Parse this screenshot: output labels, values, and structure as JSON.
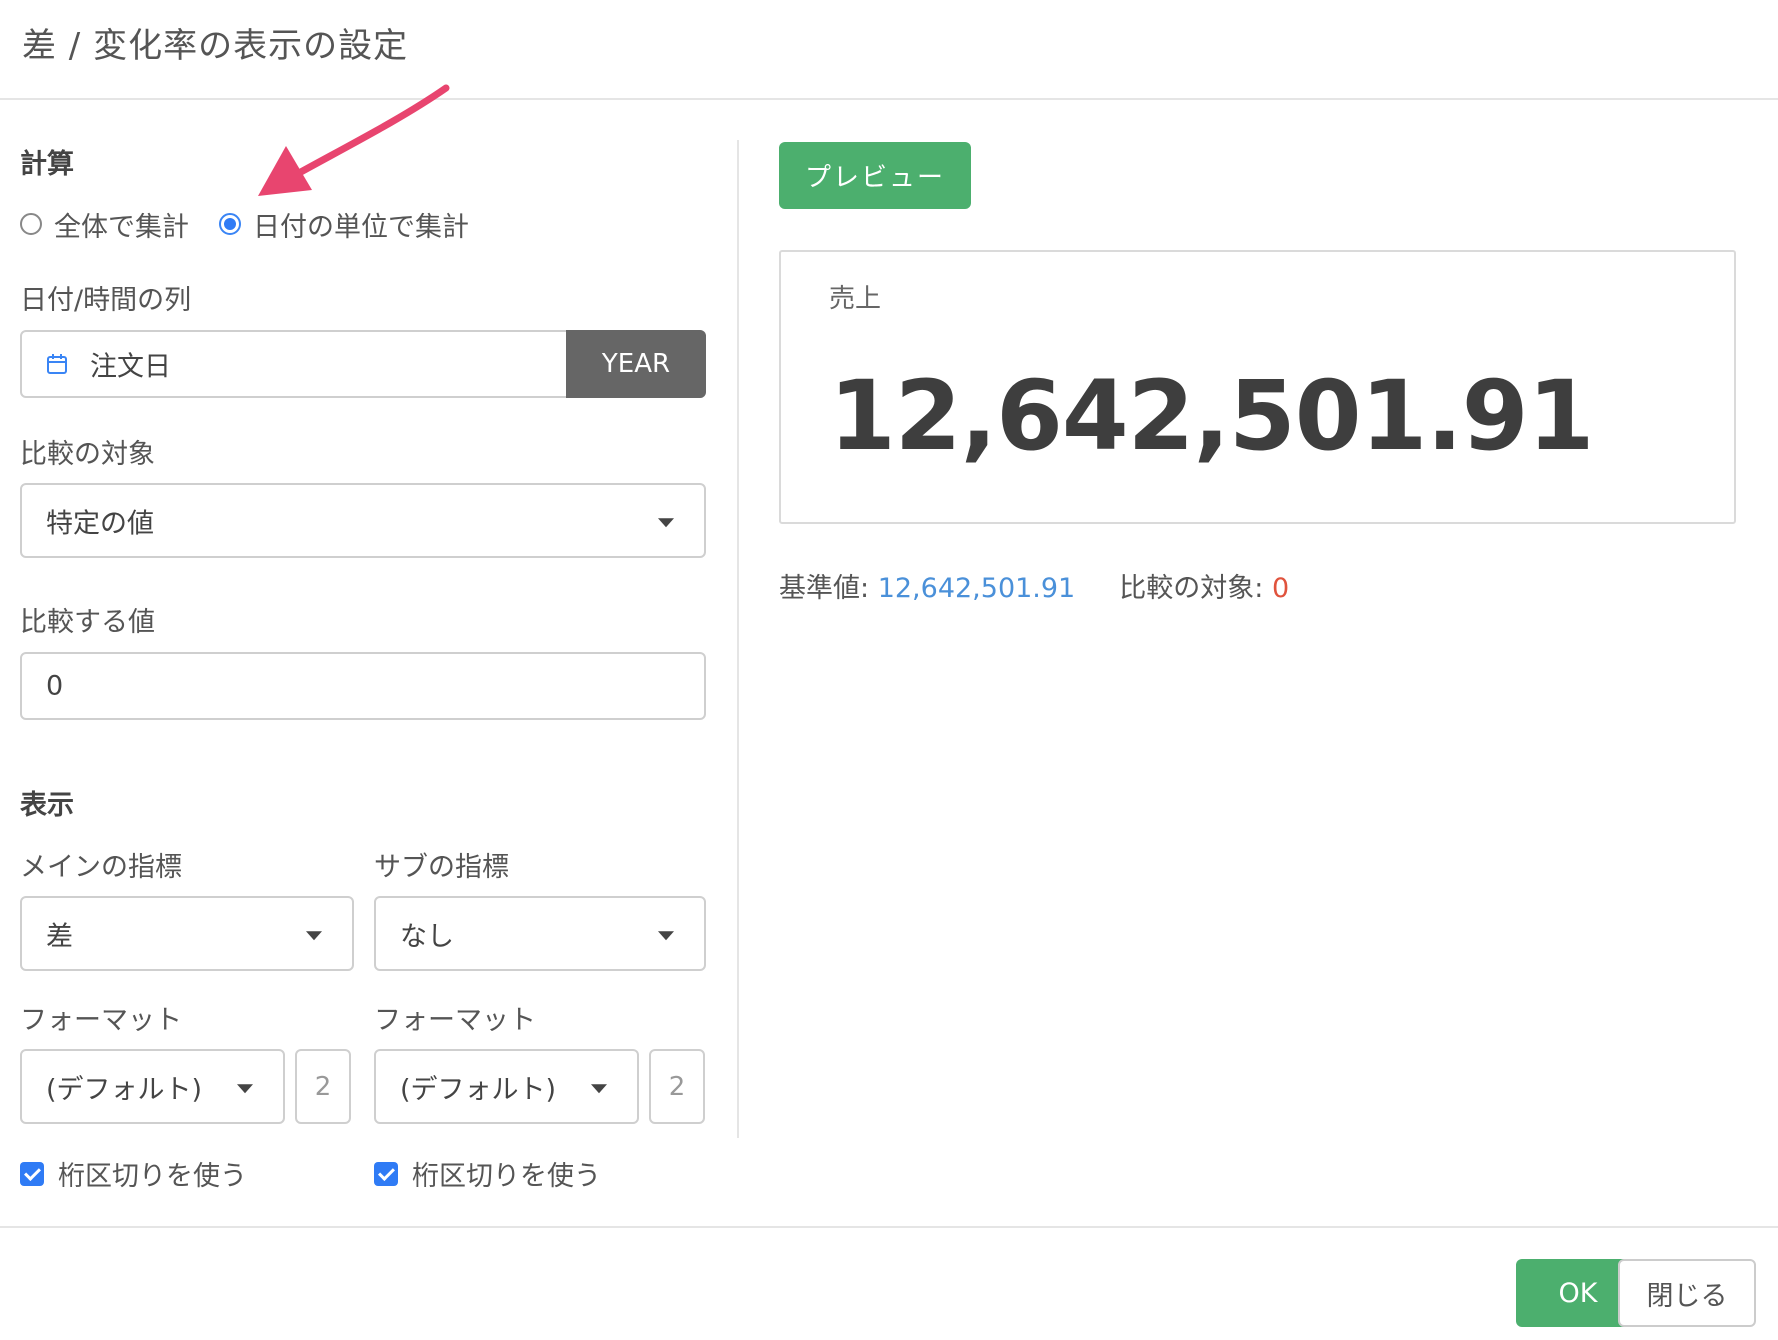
{
  "header": {
    "title": "差 / 変化率の表示の設定"
  },
  "calculation": {
    "section_title": "計算",
    "options": [
      {
        "label": "全体で集計",
        "checked": false
      },
      {
        "label": "日付の単位で集計",
        "checked": true
      }
    ]
  },
  "date_column": {
    "label": "日付/時間の列",
    "value": "注文日",
    "unit": "YEAR"
  },
  "compare_target": {
    "label": "比較の対象",
    "value": "特定の値"
  },
  "compare_value": {
    "label": "比較する値",
    "value": "0"
  },
  "display": {
    "section_title": "表示",
    "main_metric": {
      "label": "メインの指標",
      "value": "差"
    },
    "sub_metric": {
      "label": "サブの指標",
      "value": "なし"
    },
    "main_format": {
      "label": "フォーマット",
      "value": "(デフォルト)",
      "digits": "2"
    },
    "sub_format": {
      "label": "フォーマット",
      "value": "(デフォルト)",
      "digits": "2"
    },
    "main_separator": {
      "label": "桁区切りを使う",
      "checked": true
    },
    "sub_separator": {
      "label": "桁区切りを使う",
      "checked": true
    }
  },
  "preview": {
    "button_label": "プレビュー",
    "card_label": "売上",
    "card_value": "12,642,501.91",
    "base_label": "基準値:",
    "base_value": "12,642,501.91",
    "compare_label": "比較の対象:",
    "compare_value": "0"
  },
  "footer": {
    "ok_label": "OK",
    "close_label": "閉じる"
  },
  "colors": {
    "accent_green": "#4caf6e",
    "radio_blue": "#2f7bf5",
    "annotation_arrow": "#e8456f",
    "base_value_blue": "#4a90d9",
    "compare_value_red": "#e0533d"
  }
}
